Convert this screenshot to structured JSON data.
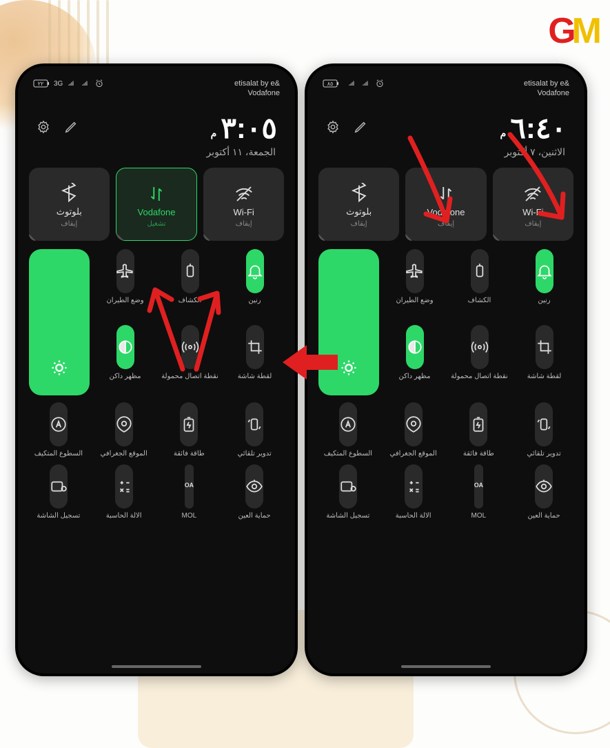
{
  "logo": {
    "g": "G",
    "m": "M"
  },
  "phones": [
    {
      "statusbar": {
        "battery": "٢٢",
        "net": "3G",
        "carriers": "etisalat by e&\nVodafone"
      },
      "clock": {
        "time": "٣:٠٥",
        "ampm": "م",
        "date": "الجمعة، ١١ أكتوبر"
      },
      "topTiles": [
        {
          "name": "Wi-Fi",
          "sub": "إيقاف",
          "active": false,
          "icon": "wifi"
        },
        {
          "name": "Vodafone",
          "sub": "تشغيل",
          "active": true,
          "icon": "data"
        },
        {
          "name": "بلوتوث",
          "sub": "إيقاف",
          "active": false,
          "icon": "bt"
        }
      ],
      "tiles": {
        "row1": [
          {
            "label": "رنين",
            "icon": "bell",
            "green": true
          },
          {
            "label": "الكشاف",
            "icon": "torch",
            "green": false
          },
          {
            "label": "وضع الطيران",
            "icon": "plane",
            "green": false
          }
        ],
        "row2": [
          {
            "label": "لقطة شاشة",
            "icon": "crop",
            "green": false
          },
          {
            "label": "نقطة اتصال محمولة",
            "icon": "hotspot",
            "green": false
          },
          {
            "label": "مظهر داكن",
            "icon": "dark",
            "green": true
          }
        ],
        "row3": [
          {
            "label": "تدوير تلقائي",
            "icon": "rotate",
            "green": false
          },
          {
            "label": "طاقة فائقة",
            "icon": "battery",
            "green": false
          },
          {
            "label": "الموقع الجغرافي",
            "icon": "loc",
            "green": false
          },
          {
            "label": "السطوع المتكيف",
            "icon": "auto",
            "green": false
          }
        ],
        "row4": [
          {
            "label": "حماية العين",
            "icon": "eye",
            "green": false
          },
          {
            "label": "MOL",
            "icon": "mol",
            "green": false
          },
          {
            "label": "الالة الحاسبة",
            "icon": "calc",
            "green": false
          },
          {
            "label": "تسجيل الشاشة",
            "icon": "rec",
            "green": false
          }
        ]
      }
    },
    {
      "statusbar": {
        "battery": "٨٥",
        "net": "",
        "carriers": "etisalat by e&\nVodafone"
      },
      "clock": {
        "time": "٦:٤٠",
        "ampm": "م",
        "date": "الاثنين، ٧ أكتوبر"
      },
      "topTiles": [
        {
          "name": "Wi-Fi",
          "sub": "إيقاف",
          "active": false,
          "icon": "wifi"
        },
        {
          "name": "Vodafone",
          "sub": "إيقاف",
          "active": false,
          "icon": "data"
        },
        {
          "name": "بلوتوث",
          "sub": "إيقاف",
          "active": false,
          "icon": "bt"
        }
      ],
      "tiles": {
        "row1": [
          {
            "label": "رنين",
            "icon": "bell",
            "green": true
          },
          {
            "label": "الكشاف",
            "icon": "torch",
            "green": false
          },
          {
            "label": "وضع الطيران",
            "icon": "plane",
            "green": false
          }
        ],
        "row2": [
          {
            "label": "لقطة شاشة",
            "icon": "crop",
            "green": false
          },
          {
            "label": "نقطة اتصال محمولة",
            "icon": "hotspot",
            "green": false
          },
          {
            "label": "مظهر داكن",
            "icon": "dark",
            "green": true
          }
        ],
        "row3": [
          {
            "label": "تدوير تلقائي",
            "icon": "rotate",
            "green": false
          },
          {
            "label": "طاقة فائقة",
            "icon": "battery",
            "green": false
          },
          {
            "label": "الموقع الجغرافي",
            "icon": "loc",
            "green": false
          },
          {
            "label": "السطوع المتكيف",
            "icon": "auto",
            "green": false
          }
        ],
        "row4": [
          {
            "label": "حماية العين",
            "icon": "eye",
            "green": false
          },
          {
            "label": "MOL",
            "icon": "mol",
            "green": false
          },
          {
            "label": "الالة الحاسبة",
            "icon": "calc",
            "green": false
          },
          {
            "label": "تسجيل الشاشة",
            "icon": "rec",
            "green": false
          }
        ]
      }
    }
  ]
}
